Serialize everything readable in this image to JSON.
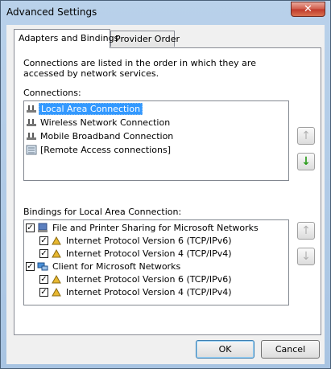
{
  "window": {
    "title": "Advanced Settings",
    "close_label": "✕"
  },
  "tabs": [
    {
      "label": "Adapters and Bindings",
      "active": true
    },
    {
      "label": "Provider Order",
      "active": false
    }
  ],
  "description": "Connections are listed in the order in which they are accessed by network services.",
  "connections": {
    "label": "Connections:",
    "items": [
      {
        "label": "Local Area Connection",
        "icon": "network-adapter-icon",
        "selected": true
      },
      {
        "label": "Wireless Network Connection",
        "icon": "network-adapter-icon",
        "selected": false
      },
      {
        "label": "Mobile Broadband Connection",
        "icon": "network-adapter-icon",
        "selected": false
      },
      {
        "label": "[Remote Access connections]",
        "icon": "remote-access-icon",
        "selected": false
      }
    ],
    "move_up": {
      "label": "↑",
      "enabled": false
    },
    "move_down": {
      "label": "↓",
      "enabled": true
    }
  },
  "bindings": {
    "label": "Bindings for Local Area Connection:",
    "items": [
      {
        "label": "File and Printer Sharing for Microsoft Networks",
        "level": 0,
        "checked": true,
        "icon": "service-icon"
      },
      {
        "label": "Internet Protocol Version 6 (TCP/IPv6)",
        "level": 1,
        "checked": true,
        "icon": "protocol-icon"
      },
      {
        "label": "Internet Protocol Version 4 (TCP/IPv4)",
        "level": 1,
        "checked": true,
        "icon": "protocol-icon"
      },
      {
        "label": "Client for Microsoft Networks",
        "level": 0,
        "checked": true,
        "icon": "client-icon"
      },
      {
        "label": "Internet Protocol Version 6 (TCP/IPv6)",
        "level": 1,
        "checked": true,
        "icon": "protocol-icon"
      },
      {
        "label": "Internet Protocol Version 4 (TCP/IPv4)",
        "level": 1,
        "checked": true,
        "icon": "protocol-icon"
      }
    ],
    "move_up": {
      "label": "↑",
      "enabled": false
    },
    "move_down": {
      "label": "↓",
      "enabled": false
    }
  },
  "buttons": {
    "ok": "OK",
    "cancel": "Cancel"
  },
  "colors": {
    "selection": "#3399ff",
    "arrow_enabled": "#2a9c1b"
  }
}
